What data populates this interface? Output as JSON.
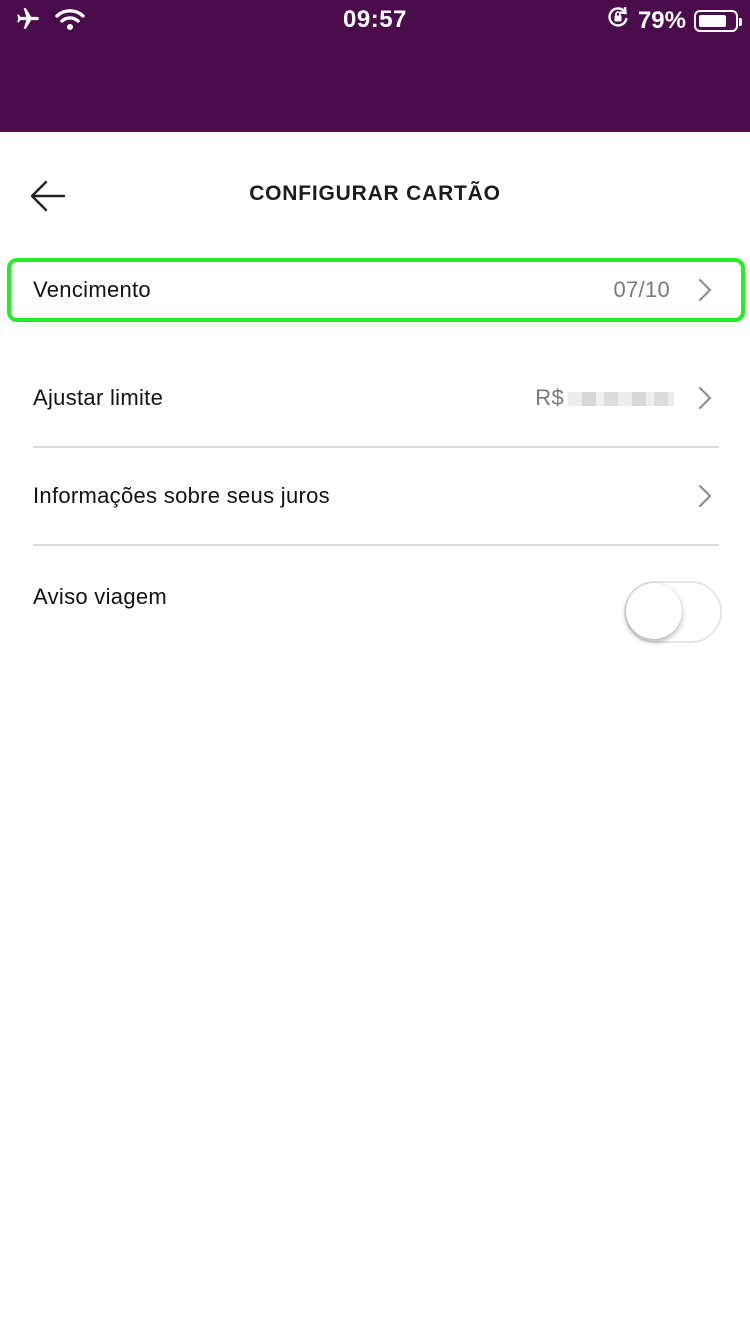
{
  "status_bar": {
    "time": "09:57",
    "battery_percent": "79%",
    "battery_level": 0.79,
    "icons": [
      "airplane-icon",
      "wifi-icon",
      "orientation-lock-icon",
      "battery-icon"
    ]
  },
  "header": {
    "title": "CONFIGURAR CARTÃO",
    "back_icon": "arrow-left-icon"
  },
  "settings": {
    "items": [
      {
        "label": "Vencimento",
        "value": "07/10",
        "chevron": "chevron-right-icon"
      },
      {
        "label": "Ajustar limite",
        "value": "R$",
        "chevron": "chevron-right-icon"
      },
      {
        "label": "Informações sobre seus juros",
        "chevron": "chevron-right-icon"
      },
      {
        "label": "Aviso viagem",
        "toggle_on": false
      }
    ]
  },
  "colors": {
    "header_bg": "#4a0c4b",
    "highlight": "#22ee22",
    "divider": "#d9d9d9"
  }
}
